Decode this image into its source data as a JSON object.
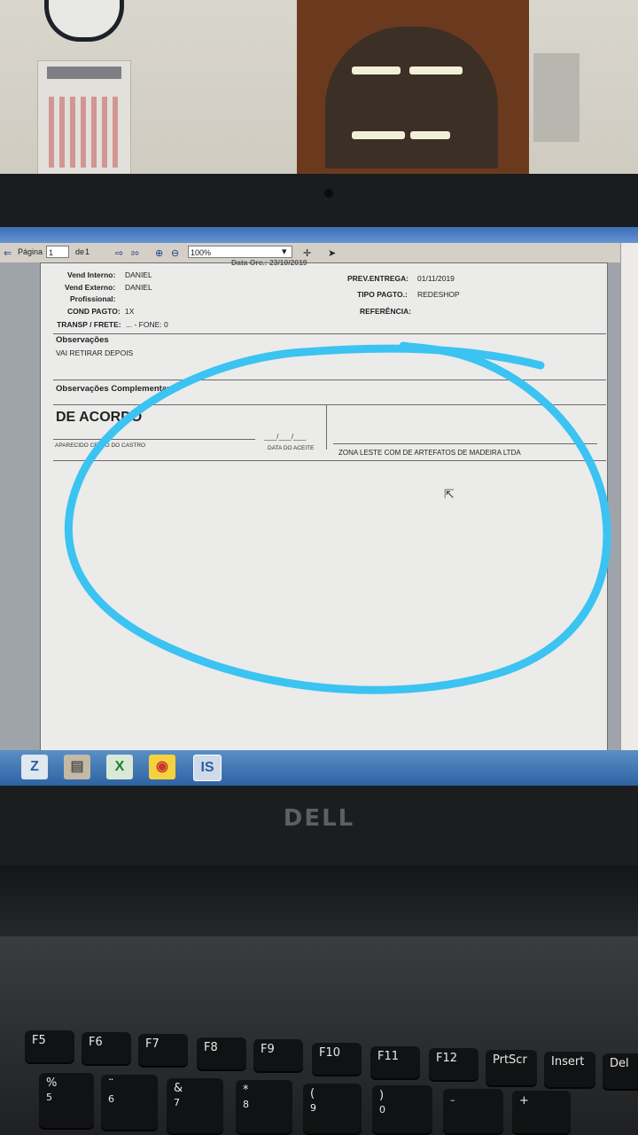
{
  "toolbar": {
    "page_label": "Página",
    "page_value": "1",
    "of_label": "de",
    "of_value": "1",
    "zoom": "100%"
  },
  "document": {
    "top_partial": "Data Orc.: 23/10/2019",
    "vend_interno_label": "Vend Interno:",
    "vend_interno_value": "DANIEL",
    "vend_externo_label": "Vend Externo:",
    "vend_externo_value": "DANIEL",
    "profissional_label": "Profissional:",
    "cond_pagto_label": "COND PAGTO:",
    "cond_pagto_value": "1X",
    "transp_label": "TRANSP / FRETE:",
    "transp_value": "... - FONE: 0",
    "prev_entrega_label": "PREV.ENTREGA:",
    "prev_entrega_value": "01/11/2019",
    "tipo_pagto_label": "TIPO PAGTO.:",
    "tipo_pagto_value": "REDESHOP",
    "referencia_label": "REFERÊNCIA:",
    "observacoes_label": "Observações",
    "observacoes_value": "VAI RETIRAR DEPOIS",
    "obs_complementares_label": "Observações Complementares",
    "de_acordo": "DE ACORDO",
    "signer_name": "APARECIDO CELSO DO CASTRO",
    "date_blank": "___/___/___",
    "data_aceite": "DATA DO ACEITE",
    "company": "ZONA LESTE COM DE ARTEFATOS DE MADEIRA LTDA"
  },
  "taskbar": {
    "apps": [
      "Z",
      "▤",
      "X",
      "◉",
      "IS"
    ]
  },
  "brand": "DELL",
  "keyboard": {
    "function_row": [
      "F5",
      "F6",
      "F7",
      "F8",
      "F9",
      "F10",
      "F11",
      "F12",
      "PrtScr",
      "Insert",
      "Del"
    ],
    "number_row": [
      {
        "top": "%",
        "bottom": "5"
      },
      {
        "top": "¨",
        "bottom": "6"
      },
      {
        "top": "&",
        "bottom": "7"
      },
      {
        "top": "*",
        "bottom": "8"
      },
      {
        "top": "(",
        "bottom": "9"
      },
      {
        "top": ")",
        "bottom": "0"
      },
      {
        "top": "",
        "bottom": "–"
      },
      {
        "top": "+",
        "bottom": ""
      }
    ]
  },
  "colors": {
    "annotation_circle": "#3bc3f2",
    "taskbar": "#3a72b5"
  }
}
